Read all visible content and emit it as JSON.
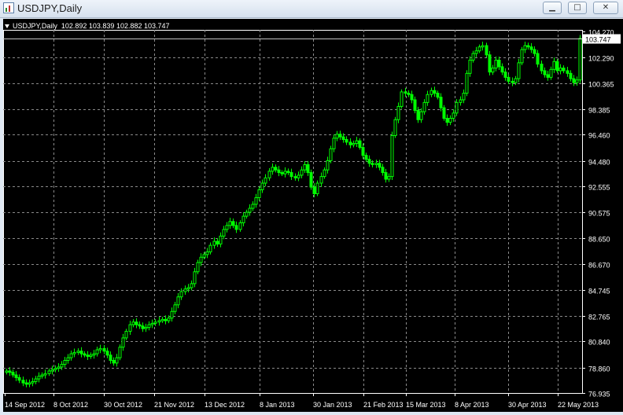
{
  "window": {
    "title": "USDJPY,Daily",
    "minimize": "▁",
    "maximize": "□",
    "close": "✕"
  },
  "header": {
    "symbol": "USDJPY,Daily",
    "ohlc": "102.892 103.839 102.882 103.747"
  },
  "colors": {
    "background": "#000000",
    "grid": "#8a8a8a",
    "candle": "#00ff00",
    "axis_text": "#ffffff"
  },
  "chart_data": {
    "type": "line",
    "style": "candlestick",
    "symbol": "USDJPY",
    "timeframe": "Daily",
    "grid": true,
    "current_price": "103.747",
    "yticks": [
      "104.270",
      "102.290",
      "100.365",
      "98.385",
      "96.460",
      "94.480",
      "92.555",
      "90.575",
      "88.650",
      "86.670",
      "84.745",
      "82.765",
      "80.840",
      "78.860",
      "76.935"
    ],
    "xticks": [
      "14 Sep 2012",
      "8 Oct 2012",
      "30 Oct 2012",
      "21 Nov 2012",
      "13 Dec 2012",
      "8 Jan 2013",
      "30 Jan 2013",
      "21 Feb 2013",
      "15 Mar 2013",
      "8 Apr 2013",
      "30 Apr 2013",
      "22 May 2013"
    ],
    "closes": [
      78.6,
      78.5,
      78.3,
      78.1,
      77.9,
      77.7,
      77.6,
      77.7,
      77.8,
      78.0,
      78.2,
      78.3,
      78.4,
      78.6,
      78.7,
      78.8,
      78.9,
      79.1,
      79.4,
      79.6,
      79.9,
      80.0,
      80.1,
      79.9,
      79.8,
      79.7,
      79.8,
      79.9,
      80.2,
      80.3,
      80.1,
      79.8,
      79.4,
      79.2,
      79.6,
      80.4,
      81.1,
      81.6,
      82.1,
      82.3,
      82.1,
      82.0,
      81.8,
      81.9,
      82.1,
      82.2,
      82.3,
      82.4,
      82.5,
      82.4,
      82.6,
      83.1,
      83.6,
      84.2,
      84.6,
      84.8,
      84.9,
      85.2,
      86.1,
      86.8,
      87.2,
      87.4,
      87.6,
      88.1,
      88.4,
      88.2,
      88.8,
      89.3,
      89.6,
      89.9,
      89.6,
      89.3,
      89.8,
      90.3,
      90.6,
      90.9,
      91.2,
      91.7,
      92.3,
      92.8,
      93.2,
      93.7,
      94.0,
      93.8,
      93.6,
      93.5,
      93.7,
      93.6,
      93.3,
      93.2,
      93.4,
      93.8,
      94.2,
      93.6,
      92.5,
      92.0,
      92.8,
      93.3,
      93.8,
      94.5,
      95.4,
      96.2,
      96.5,
      96.3,
      96.1,
      95.9,
      95.7,
      95.8,
      96.0,
      95.5,
      94.9,
      94.6,
      94.3,
      94.2,
      94.3,
      94.0,
      93.6,
      93.1,
      93.3,
      96.4,
      97.6,
      98.6,
      99.7,
      99.6,
      99.5,
      99.1,
      98.3,
      97.6,
      98.2,
      98.9,
      99.5,
      99.8,
      99.6,
      99.3,
      98.5,
      97.7,
      97.4,
      97.7,
      98.1,
      98.9,
      99.1,
      99.6,
      101.1,
      102.1,
      102.6,
      102.8,
      103.1,
      103.2,
      102.5,
      101.2,
      101.5,
      102.1,
      101.6,
      101.2,
      100.8,
      100.5,
      100.4,
      100.7,
      101.9,
      102.9,
      103.2,
      103.1,
      102.9,
      102.6,
      101.8,
      101.3,
      101.0,
      100.8,
      101.4,
      102.0,
      101.3,
      101.5,
      101.3,
      101.1,
      100.7,
      100.4,
      100.6,
      103.747
    ]
  }
}
